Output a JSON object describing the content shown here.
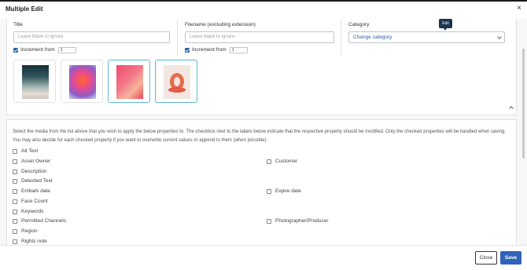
{
  "dialog": {
    "title": "Multiple Edit",
    "close_glyph": "×"
  },
  "fields": {
    "title": {
      "label": "Title",
      "placeholder": "Leave blank to ignore",
      "increment_label": "Increment from",
      "increment_value": "1",
      "increment_checked": true
    },
    "filename": {
      "label": "Filename (excluding extension)",
      "placeholder": "Leave blank to ignore",
      "increment_label": "Increment from",
      "increment_value": "1",
      "increment_checked": true
    },
    "category": {
      "label": "Category",
      "selected": "Change category"
    }
  },
  "tooltip": {
    "text": "Edit"
  },
  "media": [
    {
      "icon": "desert-dunes-image",
      "selected": false
    },
    {
      "icon": "pink-smoke-image",
      "selected": false
    },
    {
      "icon": "pink-abstract-image",
      "selected": true
    },
    {
      "icon": "coral-ribbon-image",
      "selected": true
    }
  ],
  "instructions": "Select the media from the list above that you wish to apply the below properties to. The checkbox next to the labels below indicate that the respective property should be modified. Only the checked properties will be handled when saving. You may also decide for each checked property if you want to overwrite current values or append to them (when possible).",
  "properties_left": [
    "Alt Text",
    "Asset Owner",
    "Description",
    "Detected Text",
    "Embark date",
    "Face Count",
    "Keywords",
    "Permitted Channels",
    "Region",
    "Rights note"
  ],
  "properties_right": [
    "Customer",
    "Expire date",
    "Photographer/Producer"
  ],
  "footer": {
    "close_label": "Close",
    "save_label": "Save"
  },
  "colors": {
    "primary": "#2f62b8",
    "tooltip_bg": "#19354f",
    "selected_border": "#5eb6d5"
  }
}
